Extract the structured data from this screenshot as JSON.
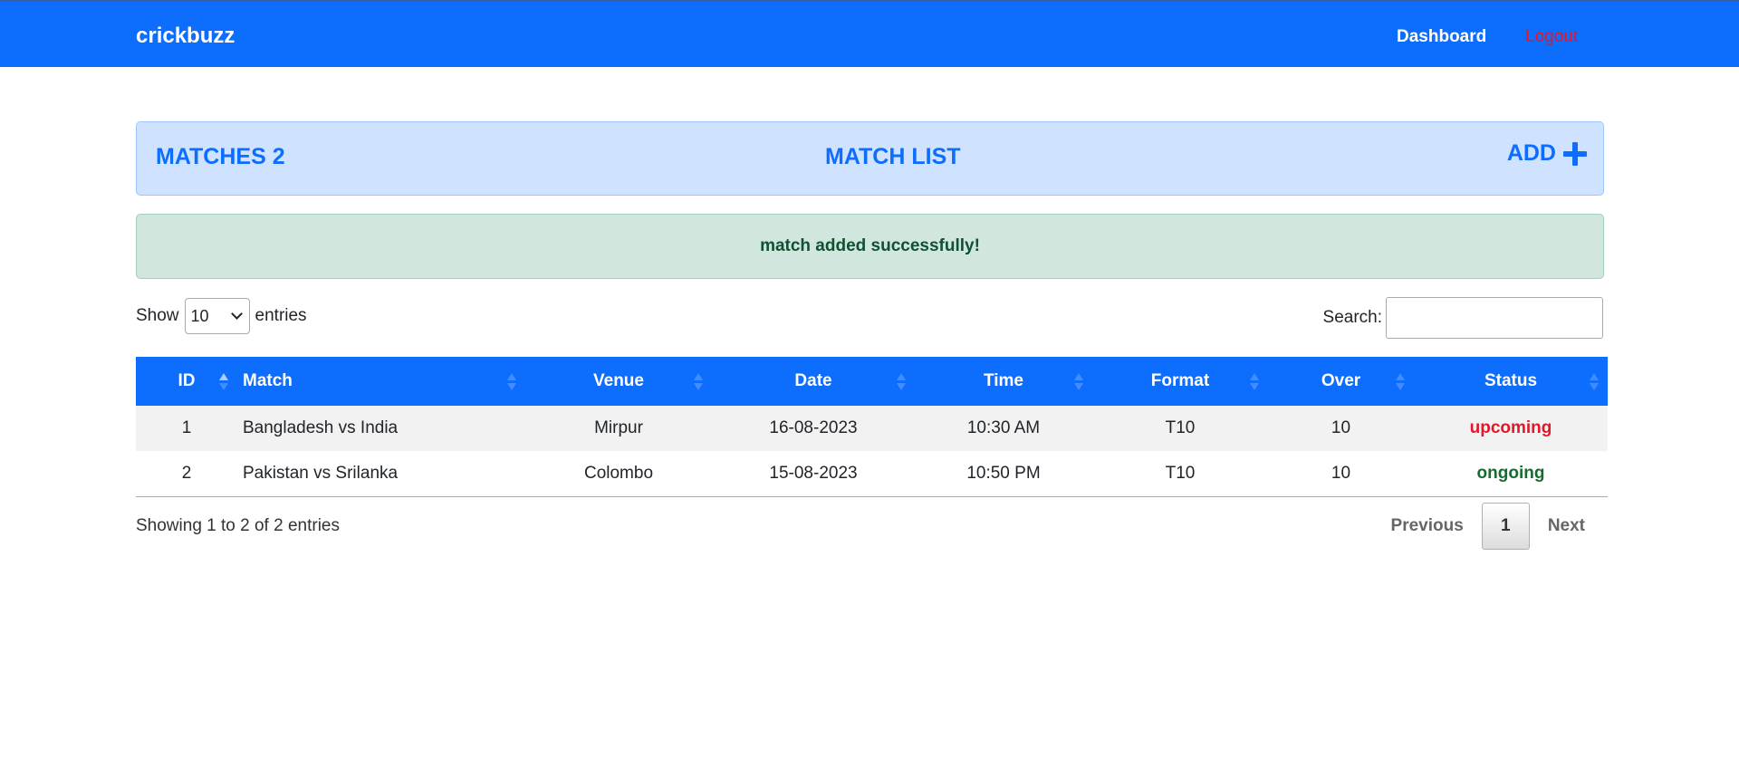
{
  "navbar": {
    "brand": "crickbuzz",
    "dashboard": "Dashboard",
    "logout": "Logout"
  },
  "header": {
    "matches_label": "MATCHES 2",
    "title": "MATCH LIST",
    "add_label": "ADD",
    "add_icon": "plus-icon"
  },
  "alert": {
    "message": "match added successfully!"
  },
  "length": {
    "show": "Show",
    "value": "10",
    "entries": "entries"
  },
  "search": {
    "label": "Search:",
    "value": ""
  },
  "table": {
    "columns": [
      "ID",
      "Match",
      "Venue",
      "Date",
      "Time",
      "Format",
      "Over",
      "Status"
    ],
    "rows": [
      {
        "id": "1",
        "match": "Bangladesh vs India",
        "venue": "Mirpur",
        "date": "16-08-2023",
        "time": "10:30 AM",
        "format": "T10",
        "over": "10",
        "status": "upcoming"
      },
      {
        "id": "2",
        "match": "Pakistan vs Srilanka",
        "venue": "Colombo",
        "date": "15-08-2023",
        "time": "10:50 PM",
        "format": "T10",
        "over": "10",
        "status": "ongoing"
      }
    ]
  },
  "footer": {
    "info": "Showing 1 to 2 of 2 entries",
    "previous": "Previous",
    "current_page": "1",
    "next": "Next"
  },
  "colors": {
    "primary": "#0d6efd",
    "upcoming": "#e0182a",
    "ongoing": "#146c2e",
    "alert_bg": "#d1e7dd",
    "header_bg": "#cfe2ff"
  }
}
